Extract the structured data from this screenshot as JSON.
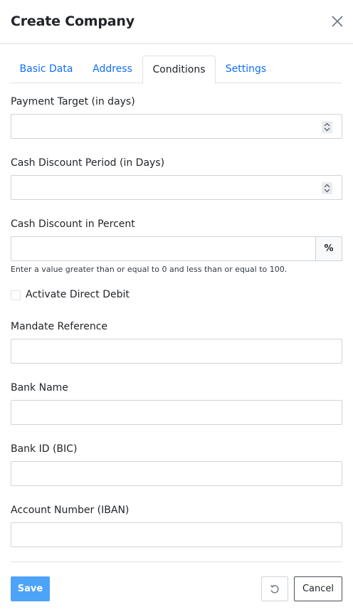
{
  "dialog": {
    "title": "Create Company"
  },
  "tabs": [
    {
      "label": "Basic Data",
      "active": false
    },
    {
      "label": "Address",
      "active": false
    },
    {
      "label": "Conditions",
      "active": true
    },
    {
      "label": "Settings",
      "active": false
    }
  ],
  "fields": {
    "payment_target": {
      "label": "Payment Target (in days)",
      "value": "",
      "icon": "spinner-icon"
    },
    "cash_discount_period": {
      "label": "Cash Discount Period (in Days)",
      "value": "",
      "icon": "spinner-icon"
    },
    "cash_discount_percent": {
      "label": "Cash Discount in Percent",
      "value": "",
      "addon": "%",
      "help": "Enter a value greater than or equal to 0 and less than or equal to 100."
    },
    "direct_debit": {
      "label": "Activate Direct Debit",
      "checked": false
    },
    "mandate_reference": {
      "label": "Mandate Reference",
      "value": ""
    },
    "bank_name": {
      "label": "Bank Name",
      "value": ""
    },
    "bank_id": {
      "label": "Bank ID (BIC)",
      "value": ""
    },
    "account_number": {
      "label": "Account Number (IBAN)",
      "value": ""
    }
  },
  "footer": {
    "save_label": "Save",
    "cancel_label": "Cancel",
    "reset_icon": "reset-icon"
  },
  "colors": {
    "primary": "#4da3f7",
    "link": "#0d6efd",
    "border": "#ced4da"
  }
}
